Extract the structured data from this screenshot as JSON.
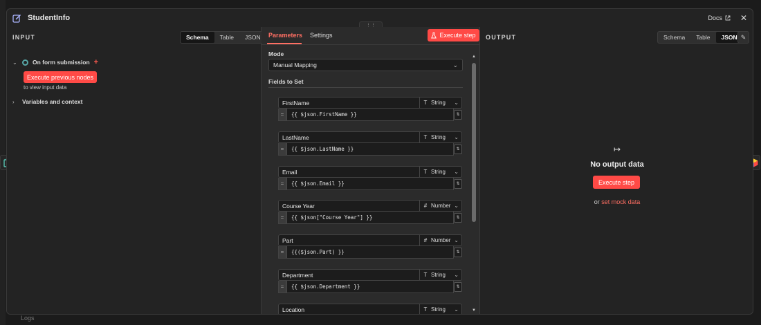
{
  "window": {
    "title": "StudentInfo",
    "docs_label": "Docs",
    "close_label": "✕",
    "handle_label": "⋮⋮",
    "background_logs": "Logs"
  },
  "input_panel": {
    "title": "INPUT",
    "view_tabs": [
      "Schema",
      "Table",
      "JSON"
    ],
    "active_view": "Schema",
    "trigger_node": "On form submission",
    "execute_prev_label": "Execute previous nodes",
    "hint": "to view input data",
    "variables_label": "Variables and context"
  },
  "parameters_panel": {
    "tabs": [
      "Parameters",
      "Settings"
    ],
    "active_tab": "Parameters",
    "execute_step_label": "Execute step",
    "mode_label": "Mode",
    "mode_value": "Manual Mapping",
    "fields_label": "Fields to Set",
    "fields": [
      {
        "name": "FirstName",
        "type": "String",
        "type_icon": "T",
        "value": "{{ $json.FirstName }}"
      },
      {
        "name": "LastName",
        "type": "String",
        "type_icon": "T",
        "value": "{{ $json.LastName }}"
      },
      {
        "name": "Email",
        "type": "String",
        "type_icon": "T",
        "value": "{{ $json.Email }}"
      },
      {
        "name": "Course Year",
        "type": "Number",
        "type_icon": "#",
        "value": "{{ $json[\"Course Year\"] }}"
      },
      {
        "name": "Part",
        "type": "Number",
        "type_icon": "#",
        "value": "{{($json.Part) }}"
      },
      {
        "name": "Department",
        "type": "String",
        "type_icon": "T",
        "value": "{{ $json.Department }}"
      },
      {
        "name": "Location",
        "type": "String",
        "type_icon": "T",
        "value": ""
      }
    ]
  },
  "output_panel": {
    "title": "OUTPUT",
    "view_tabs": [
      "Schema",
      "Table",
      "JSON"
    ],
    "active_view": "JSON",
    "no_data_label": "No output data",
    "execute_step_label": "Execute step",
    "or_label": "or",
    "mock_link": "set mock data"
  },
  "colors": {
    "accent": "#ff4a46",
    "accent_text": "#ff6f63",
    "panel_bg": "#232323",
    "param_bg": "#2b2b2b"
  }
}
